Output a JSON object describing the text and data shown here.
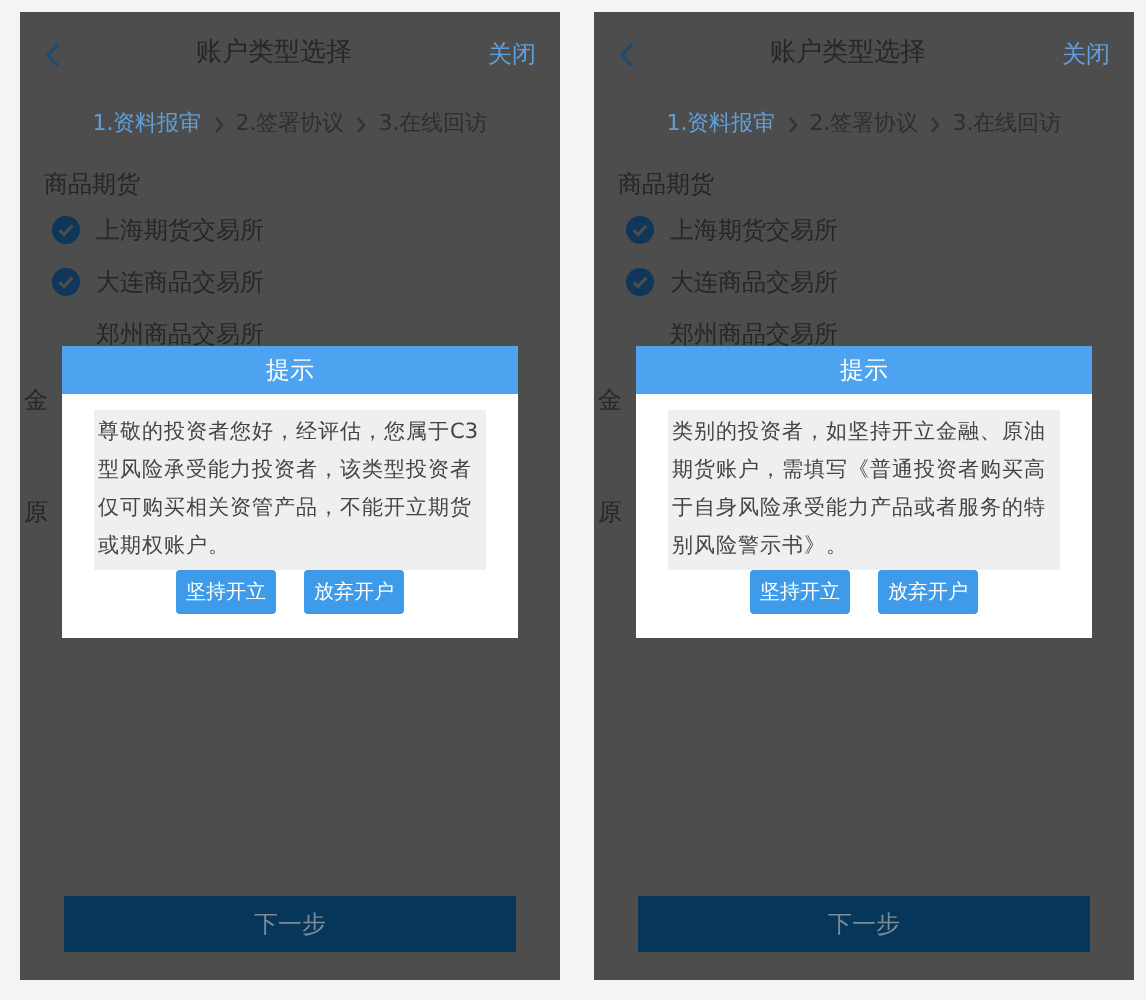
{
  "screens": [
    {
      "header": {
        "title": "账户类型选择",
        "close": "关闭"
      },
      "steps": [
        {
          "label": "1.资料报审",
          "selected": true
        },
        {
          "label": "2.签署协议",
          "selected": false
        },
        {
          "label": "3.在线回访",
          "selected": false
        }
      ],
      "section": {
        "title": "商品期货",
        "items": [
          {
            "label": "上海期货交易所",
            "checked": true
          },
          {
            "label": "大连商品交易所",
            "checked": true
          },
          {
            "label": "郑州商品交易所"
          }
        ]
      },
      "other_sections": [
        {
          "title": "金"
        },
        {
          "title": "原"
        }
      ],
      "dialog": {
        "title": "提示",
        "message": "尊敬的投资者您好，经评估，您属于C3型风险承受能力投资者，该类型投资者仅可购买相关资管产品，不能开立期货或期权账户。",
        "buttons": [
          "坚持开立",
          "放弃开户"
        ]
      },
      "next_button": "下一步"
    },
    {
      "header": {
        "title": "账户类型选择",
        "close": "关闭"
      },
      "steps": [
        {
          "label": "1.资料报审",
          "selected": true
        },
        {
          "label": "2.签署协议",
          "selected": false
        },
        {
          "label": "3.在线回访",
          "selected": false
        }
      ],
      "section": {
        "title": "商品期货",
        "items": [
          {
            "label": "上海期货交易所",
            "checked": true
          },
          {
            "label": "大连商品交易所",
            "checked": true
          },
          {
            "label": "郑州商品交易所"
          }
        ]
      },
      "other_sections": [
        {
          "title": "金"
        },
        {
          "title": "原"
        }
      ],
      "dialog": {
        "title": "提示",
        "message": "类别的投资者，如坚持开立金融、原油期货账户，需填写《普通投资者购买高于自身风险承受能力产品或者服务的特别风险警示书》。",
        "buttons": [
          "坚持开立",
          "放弃开户"
        ]
      },
      "next_button": "下一步"
    }
  ]
}
